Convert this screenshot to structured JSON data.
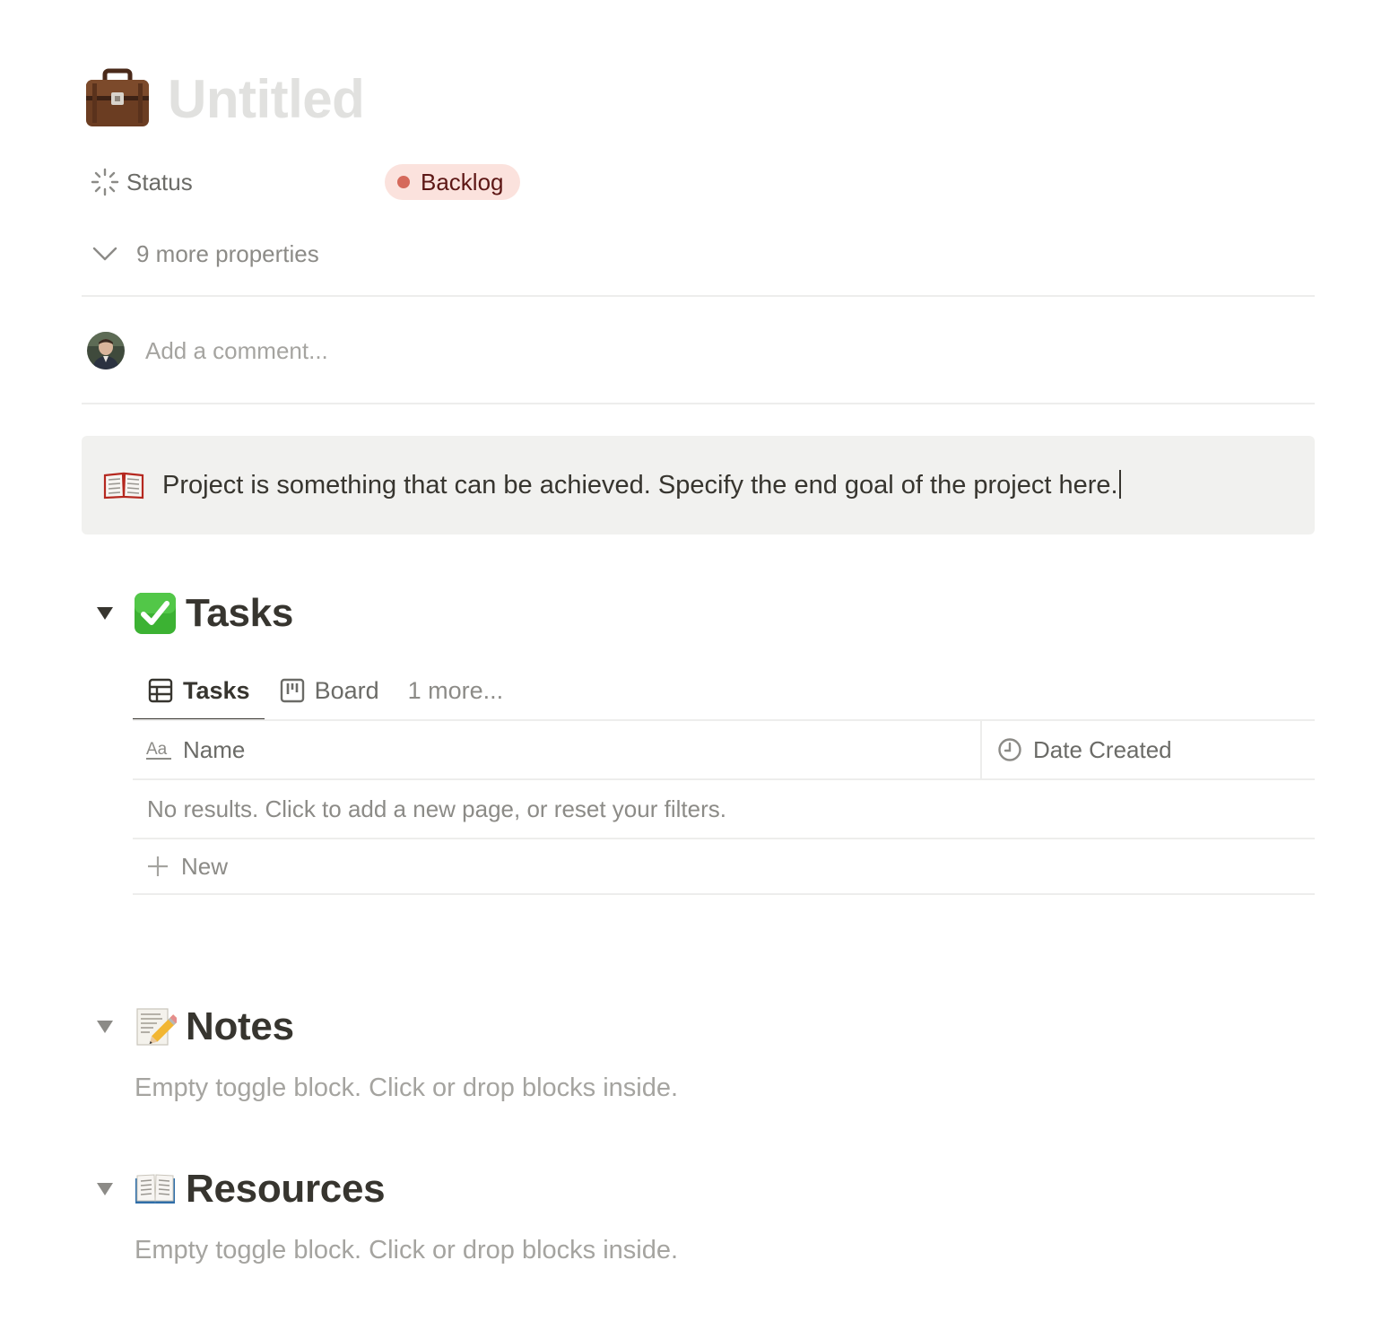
{
  "page": {
    "icon": "briefcase-icon",
    "title": "Untitled"
  },
  "properties": {
    "status": {
      "icon": "status-spinner-icon",
      "label": "Status",
      "value": "Backlog",
      "pill_bg": "#fbe2dd",
      "pill_text": "#5d1715",
      "dot_color": "#d5695b"
    },
    "more_label": "9 more properties"
  },
  "comment": {
    "placeholder": "Add a comment..."
  },
  "callout": {
    "icon": "open-book-icon",
    "text": "Project is something that can be achieved. Specify the end goal of the project here."
  },
  "sections": {
    "tasks": {
      "emoji": "check-mark-button-icon",
      "title": "Tasks",
      "views": [
        {
          "label": "Tasks",
          "icon": "table-icon",
          "active": true
        },
        {
          "label": "Board",
          "icon": "board-icon",
          "active": false
        },
        {
          "label": "1 more...",
          "icon": "",
          "active": false
        }
      ],
      "table": {
        "columns": [
          {
            "label": "Name",
            "icon": "text-aa-icon"
          },
          {
            "label": "Date Created",
            "icon": "clock-icon"
          }
        ],
        "empty_text": "No results. Click to add a new page, or reset your filters.",
        "new_label": "New"
      }
    },
    "notes": {
      "emoji": "memo-icon",
      "title": "Notes",
      "empty_text": "Empty toggle block. Click or drop blocks inside."
    },
    "resources": {
      "emoji": "open-book-icon",
      "title": "Resources",
      "empty_text": "Empty toggle block. Click or drop blocks inside."
    }
  },
  "colors": {
    "text": "#37352f",
    "muted": "#8c8b87",
    "placeholder": "#a5a4a0",
    "divider": "#ededec",
    "callout_bg": "#f1f1ef",
    "title_placeholder": "#e1e1df"
  }
}
